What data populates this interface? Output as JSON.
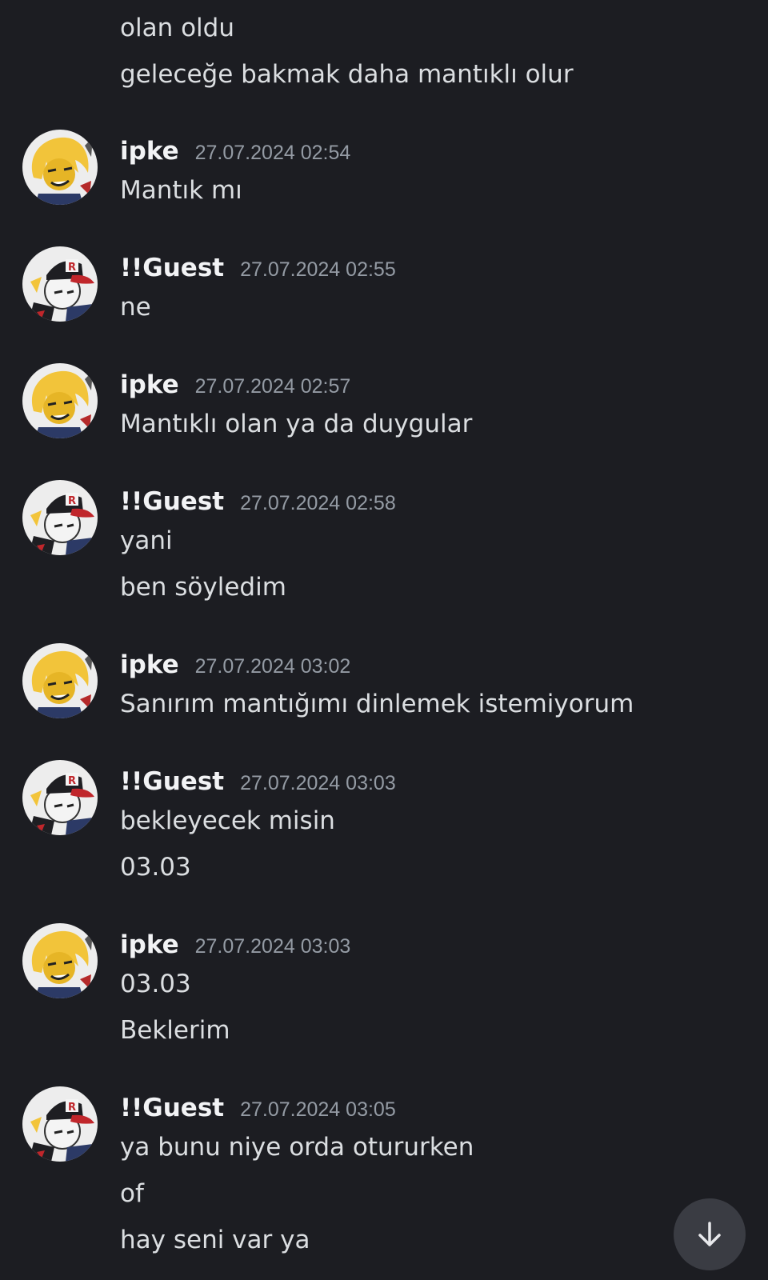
{
  "chat": {
    "continuation": {
      "lines": [
        "olan oldu",
        "geleceğe bakmak daha mantıklı olur"
      ]
    },
    "messages": [
      {
        "author": "ipke",
        "avatar": "ipke-avatar",
        "timestamp": "27.07.2024 02:54",
        "lines": [
          "Mantık mı"
        ]
      },
      {
        "author": "!!Guest",
        "avatar": "guest-avatar",
        "timestamp": "27.07.2024 02:55",
        "lines": [
          "ne"
        ]
      },
      {
        "author": "ipke",
        "avatar": "ipke-avatar",
        "timestamp": "27.07.2024 02:57",
        "lines": [
          "Mantıklı olan ya da duygular"
        ]
      },
      {
        "author": "!!Guest",
        "avatar": "guest-avatar",
        "timestamp": "27.07.2024 02:58",
        "lines": [
          "yani",
          "ben söyledim"
        ]
      },
      {
        "author": "ipke",
        "avatar": "ipke-avatar",
        "timestamp": "27.07.2024 03:02",
        "lines": [
          "Sanırım mantığımı dinlemek istemiyorum"
        ]
      },
      {
        "author": "!!Guest",
        "avatar": "guest-avatar",
        "timestamp": "27.07.2024 03:03",
        "lines": [
          "bekleyecek misin",
          "03.03"
        ]
      },
      {
        "author": "ipke",
        "avatar": "ipke-avatar",
        "timestamp": "27.07.2024 03:03",
        "lines": [
          "03.03",
          "Beklerim"
        ]
      },
      {
        "author": "!!Guest",
        "avatar": "guest-avatar",
        "timestamp": "27.07.2024 03:05",
        "lines": [
          "ya bunu niye orda otururken",
          "of",
          "hay seni var ya"
        ]
      }
    ]
  },
  "scroll_button": {
    "icon": "arrow-down-icon"
  },
  "colors": {
    "background": "#1c1d22",
    "message_text": "#dbdee1",
    "author_text": "#f2f3f5",
    "timestamp_text": "#949ba4",
    "scroll_button_bg": "#3a3c43"
  }
}
